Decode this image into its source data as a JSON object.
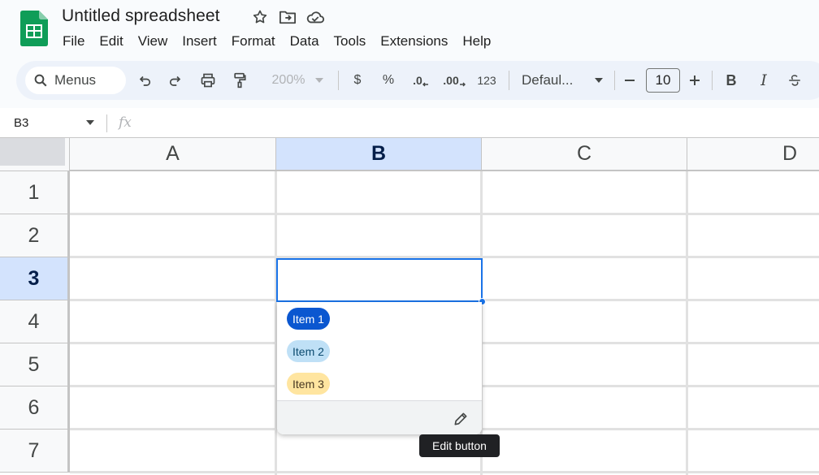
{
  "document": {
    "title": "Untitled spreadsheet"
  },
  "menubar": [
    "File",
    "Edit",
    "View",
    "Insert",
    "Format",
    "Data",
    "Tools",
    "Extensions",
    "Help"
  ],
  "toolbar": {
    "search_label": "Menus",
    "zoom": "200%",
    "currency": "$",
    "percent": "%",
    "decrease_decimal": ".0",
    "increase_decimal": ".00",
    "number_format": "123",
    "font_name": "Defaul...",
    "font_size": "10",
    "bold": "B",
    "italic": "I"
  },
  "formula_bar": {
    "cell_ref": "B3",
    "fx": "fx"
  },
  "grid": {
    "columns": [
      "A",
      "B",
      "C",
      "D"
    ],
    "rows": [
      "1",
      "2",
      "3",
      "4",
      "5",
      "6",
      "7"
    ],
    "selected_column": "B",
    "selected_row": "3"
  },
  "dropdown": {
    "items": [
      {
        "label": "Item 1",
        "bg": "#0b57d0",
        "fg": "#ffffff"
      },
      {
        "label": "Item 2",
        "bg": "#bfe0f6",
        "fg": "#0b4a6f"
      },
      {
        "label": "Item 3",
        "bg": "#ffe5a0",
        "fg": "#473822"
      }
    ]
  },
  "tooltip": {
    "text": "Edit button"
  },
  "colors": {
    "accent": "#1a73e8",
    "selection": "#d3e3fd",
    "sheets_green": "#0f9d58"
  }
}
